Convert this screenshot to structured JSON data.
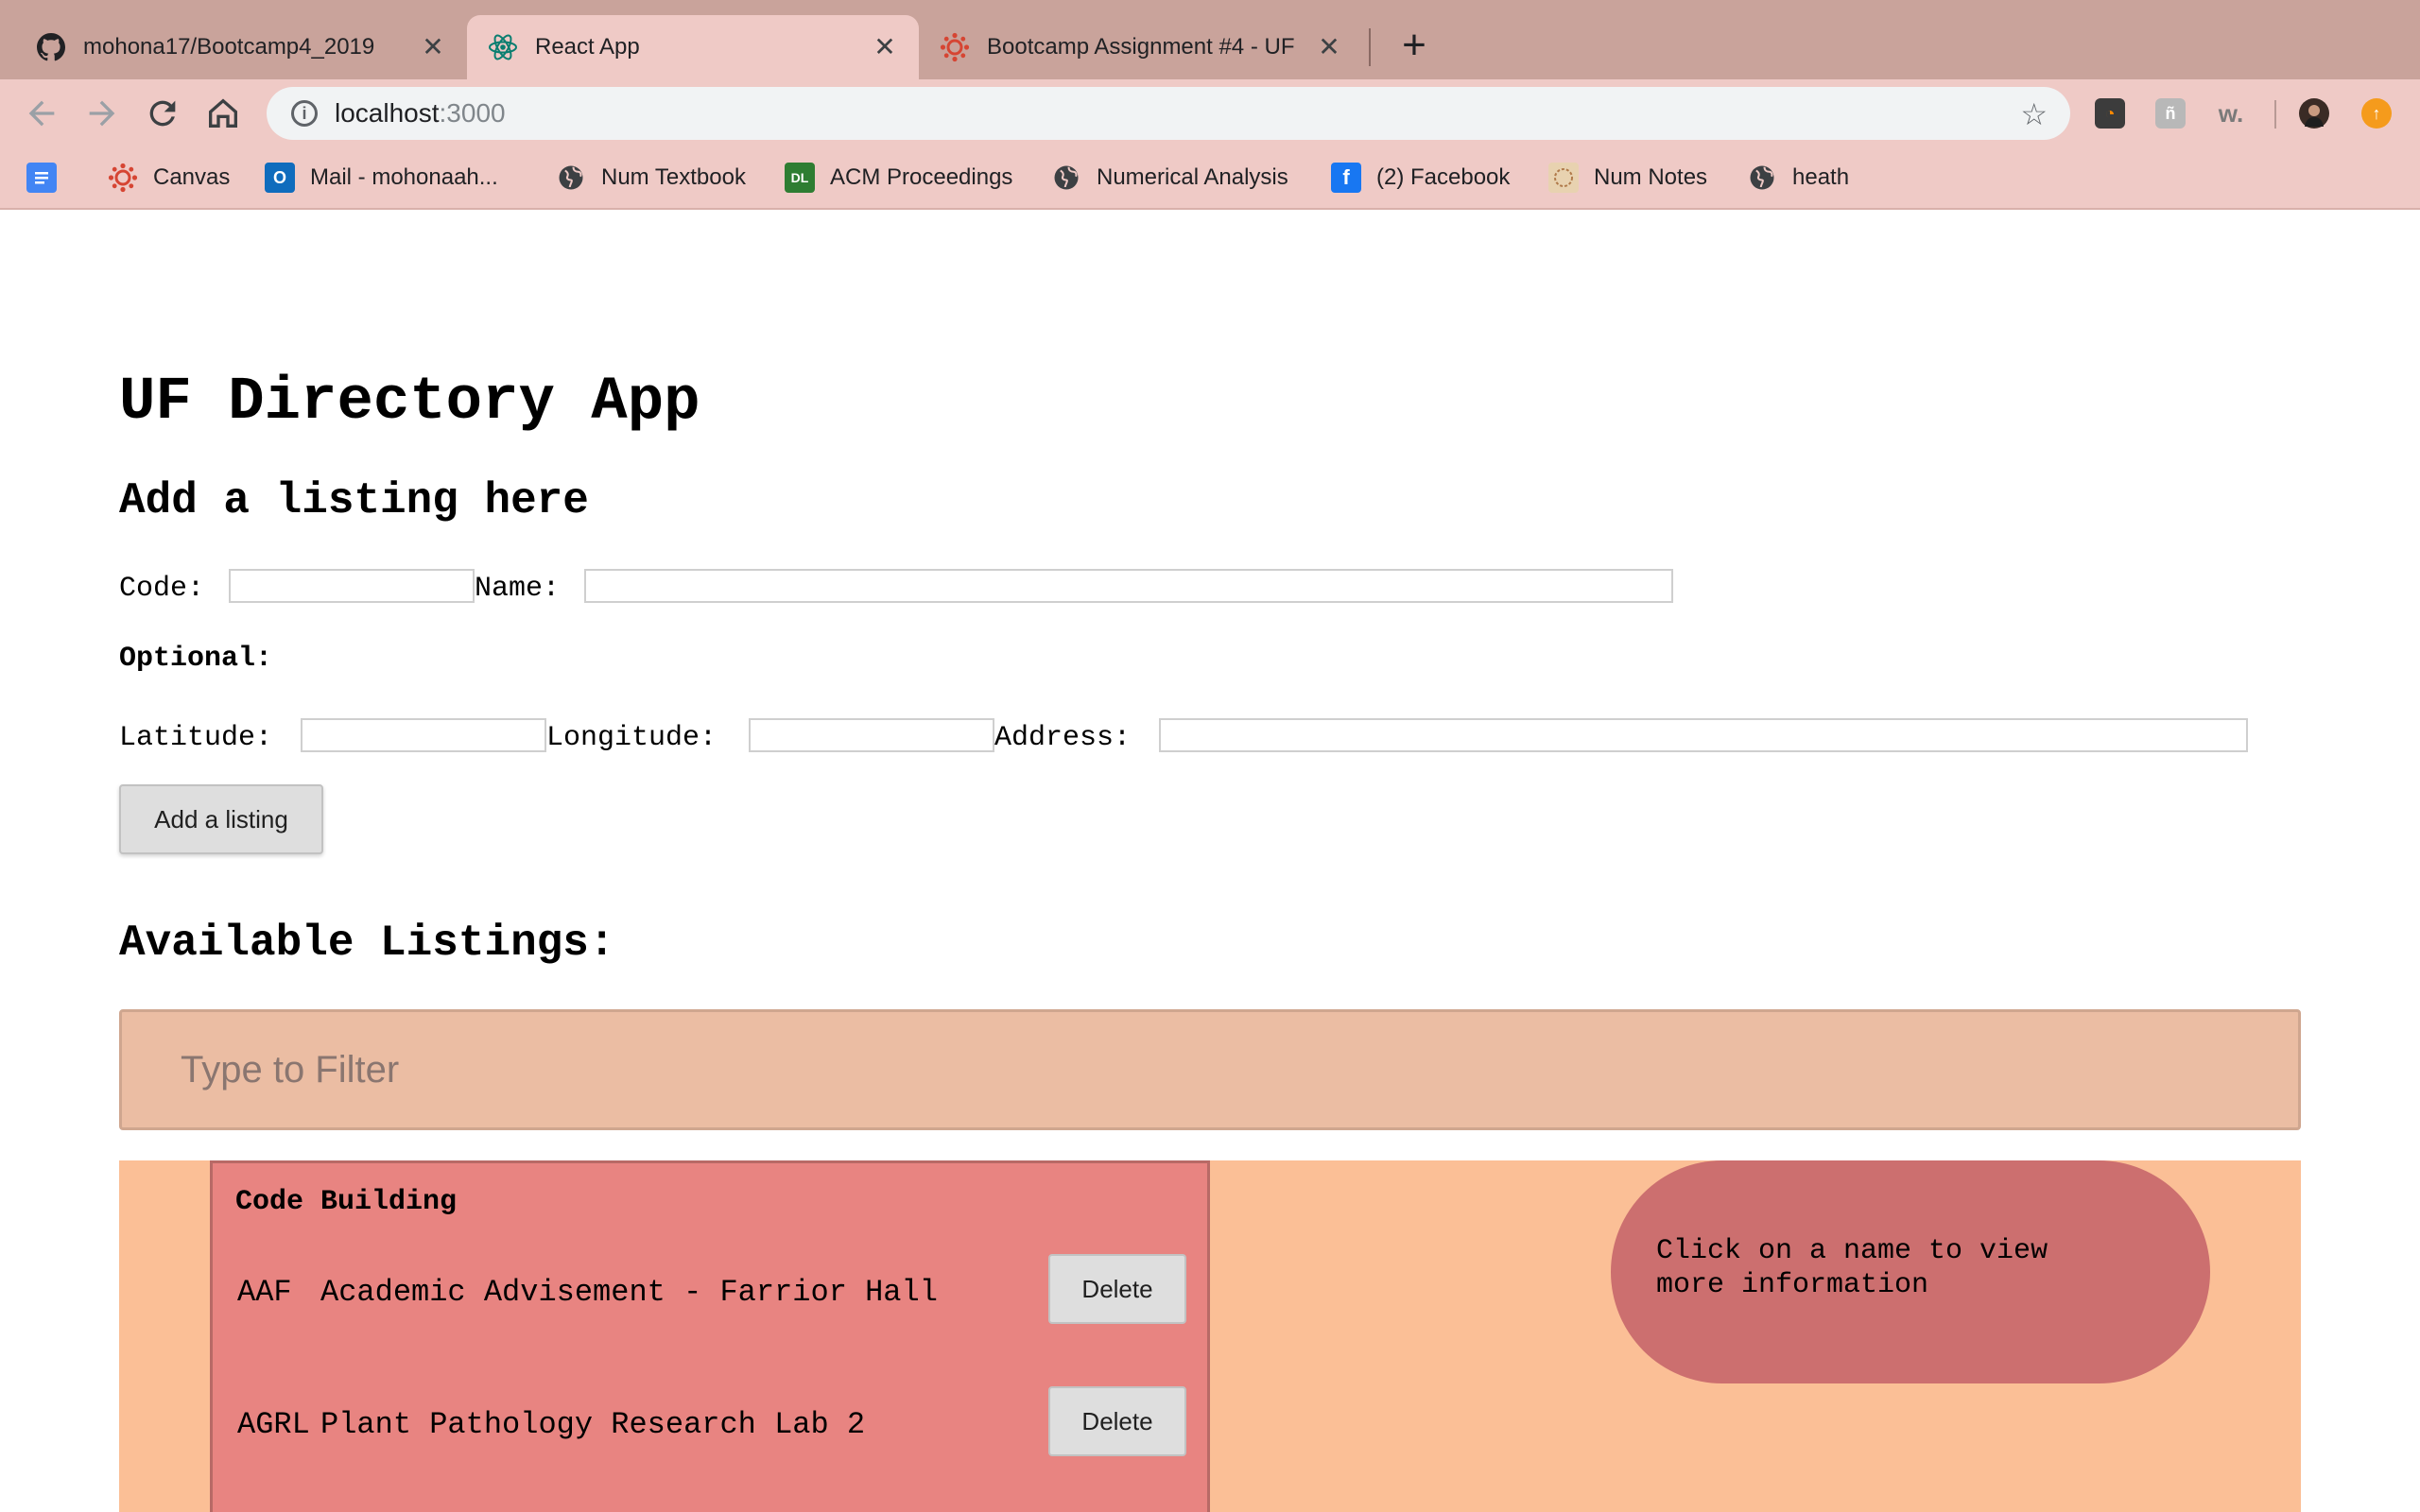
{
  "browser": {
    "tabs": [
      {
        "title": "mohona17/Bootcamp4_2019",
        "icon": "github-icon",
        "active": false
      },
      {
        "title": "React App",
        "icon": "react-icon",
        "active": true
      },
      {
        "title": "Bootcamp Assignment #4 - UF",
        "icon": "canvas-icon",
        "active": false
      }
    ],
    "close_glyph": "✕",
    "new_tab_glyph": "+",
    "url_host": "localhost",
    "url_port": ":3000",
    "bookmarks": [
      {
        "label": "Canvas",
        "icon": "canvas-icon"
      },
      {
        "label": "Mail - mohonaah...",
        "icon": "outlook-icon"
      },
      {
        "label": "Num Textbook",
        "icon": "globe-icon"
      },
      {
        "label": "ACM Proceedings",
        "icon": "acm-icon"
      },
      {
        "label": "Numerical Analysis",
        "icon": "globe-icon"
      },
      {
        "label": "(2) Facebook",
        "icon": "facebook-icon"
      },
      {
        "label": "Num Notes",
        "icon": "notes-icon"
      },
      {
        "label": "heath",
        "icon": "globe-icon"
      }
    ],
    "colors": {
      "tabstrip": "#c9a39b",
      "toolbar": "#efcac6"
    }
  },
  "app": {
    "title": "UF Directory App",
    "add_heading": "Add a listing here",
    "form": {
      "code_label": "Code:",
      "name_label": "Name:",
      "optional_label": "Optional:",
      "latitude_label": "Latitude:",
      "longitude_label": "Longitude:",
      "address_label": "Address:",
      "code_value": "",
      "name_value": "",
      "latitude_value": "",
      "longitude_value": "",
      "address_value": "",
      "submit_label": "Add a listing"
    },
    "available_heading": "Available Listings:",
    "filter_placeholder": "Type to Filter",
    "table_header": "Code Building",
    "listings": [
      {
        "code": "AAF",
        "name": "Academic Advisement - Farrior Hall",
        "delete_label": "Delete"
      },
      {
        "code": "AGRL",
        "name": "Plant Pathology Research Lab 2",
        "delete_label": "Delete"
      }
    ],
    "info_text": "Click on a name to view\nmore information",
    "colors": {
      "filter_bg": "#ebbda3",
      "listings_bg": "#fbbf96",
      "table_bg": "#e88481",
      "bubble_bg": "#cc6f6f"
    }
  }
}
